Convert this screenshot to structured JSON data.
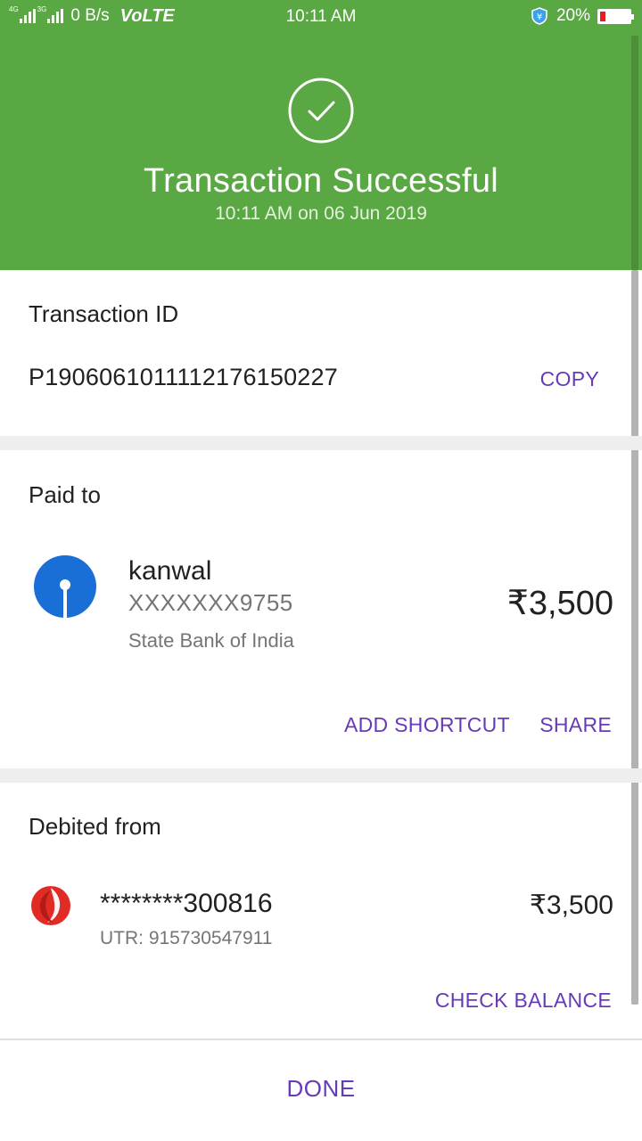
{
  "status_bar": {
    "net_label_1": "4G",
    "net_label_2": "3G",
    "speed": "0 B/s",
    "volte": "VoLTE",
    "time": "10:11 AM",
    "battery": "20%",
    "battery_level": 0.2
  },
  "header": {
    "title": "Transaction Successful",
    "subtitle": "10:11 AM on 06 Jun 2019",
    "icon": "check-circle-icon",
    "color": "#5aa843"
  },
  "transaction": {
    "label": "Transaction ID",
    "id": "P1906061011112176150227",
    "copy_label": "COPY"
  },
  "paid_to": {
    "label": "Paid to",
    "name": "kanwal",
    "account": "XXXXXXX9755",
    "bank": "State Bank of India",
    "amount": "₹3,500",
    "add_shortcut_label": "ADD SHORTCUT",
    "share_label": "SHARE",
    "icon": "sbi-logo-icon"
  },
  "debited_from": {
    "label": "Debited from",
    "account": "********300816",
    "utr": "UTR: 915730547911",
    "amount": "₹3,500",
    "check_balance_label": "CHECK BALANCE",
    "icon": "bank-logo-icon"
  },
  "footer": {
    "done_label": "DONE"
  },
  "colors": {
    "accent": "#673ab7",
    "success": "#5aa843",
    "sbi_blue": "#1a6fd6",
    "bank_red": "#e12b25"
  }
}
